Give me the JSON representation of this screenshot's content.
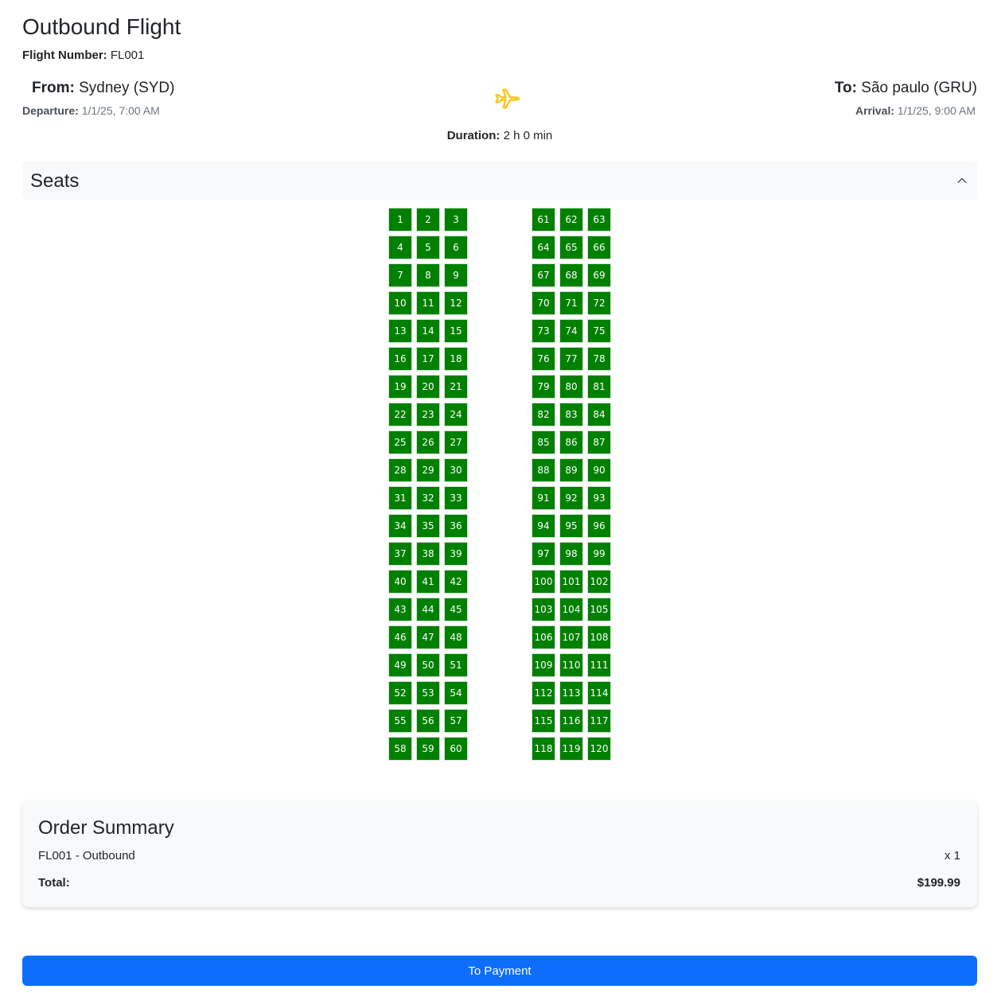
{
  "header": {
    "title": "Outbound Flight",
    "flight_number_label": "Flight Number:",
    "flight_number": "FL001"
  },
  "route": {
    "from_label": "From:",
    "from": "Sydney (SYD)",
    "departure_label": "Departure:",
    "departure": "1/1/25, 7:00 AM",
    "to_label": "To:",
    "to": "São paulo (GRU)",
    "arrival_label": "Arrival:",
    "arrival": "1/1/25, 9:00 AM",
    "duration_label": "Duration:",
    "duration": "2 h 0 min",
    "plane_icon": "airplane-icon",
    "plane_color": "#f5c518"
  },
  "seats": {
    "title": "Seats",
    "expanded": true,
    "seat_color": "#008000",
    "left_block": [
      "1",
      "2",
      "3",
      "4",
      "5",
      "6",
      "7",
      "8",
      "9",
      "10",
      "11",
      "12",
      "13",
      "14",
      "15",
      "16",
      "17",
      "18",
      "19",
      "20",
      "21",
      "22",
      "23",
      "24",
      "25",
      "26",
      "27",
      "28",
      "29",
      "30",
      "31",
      "32",
      "33",
      "34",
      "35",
      "36",
      "37",
      "38",
      "39",
      "40",
      "41",
      "42",
      "43",
      "44",
      "45",
      "46",
      "47",
      "48",
      "49",
      "50",
      "51",
      "52",
      "53",
      "54",
      "55",
      "56",
      "57",
      "58",
      "59",
      "60"
    ],
    "right_block": [
      "61",
      "62",
      "63",
      "64",
      "65",
      "66",
      "67",
      "68",
      "69",
      "70",
      "71",
      "72",
      "73",
      "74",
      "75",
      "76",
      "77",
      "78",
      "79",
      "80",
      "81",
      "82",
      "83",
      "84",
      "85",
      "86",
      "87",
      "88",
      "89",
      "90",
      "91",
      "92",
      "93",
      "94",
      "95",
      "96",
      "97",
      "98",
      "99",
      "100",
      "101",
      "102",
      "103",
      "104",
      "105",
      "106",
      "107",
      "108",
      "109",
      "110",
      "111",
      "112",
      "113",
      "114",
      "115",
      "116",
      "117",
      "118",
      "119",
      "120"
    ]
  },
  "order_summary": {
    "title": "Order Summary",
    "item": "FL001 - Outbound",
    "quantity": "x 1",
    "total_label": "Total:",
    "total": "$199.99"
  },
  "actions": {
    "pay_label": "To Payment",
    "pay_color": "#0d6efd"
  }
}
